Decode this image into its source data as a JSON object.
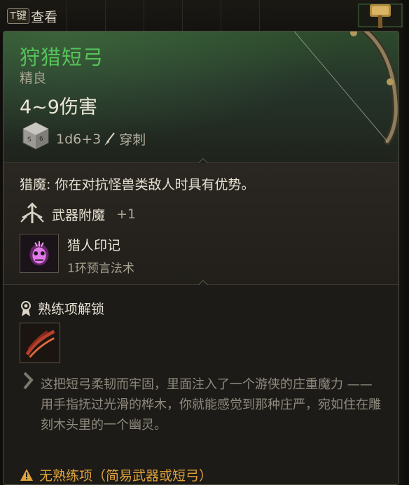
{
  "hotkey": {
    "key": "T键",
    "label": "查看"
  },
  "item": {
    "name": "狩猎短弓",
    "rarity": "精良",
    "damage": "4~9伤害",
    "damage_dice": "1d6+3",
    "damage_type": "穿刺",
    "name_color": "#56c35a"
  },
  "passive": {
    "label": "猎魔:",
    "text": "你在对抗怪兽类敌人时具有优势。"
  },
  "enchant": {
    "label": "武器附魔",
    "bonus": "+1"
  },
  "spell": {
    "name": "猎人印记",
    "level": "1环预言法术",
    "icon": "hunters-mark-icon"
  },
  "proficiency": {
    "label": "熟练项解锁",
    "icon": "slash-attack-icon"
  },
  "lore": {
    "p1": "这把短弓柔韧而牢固，里面注入了一个游侠的庄重魔力 ——",
    "p2": "用手指抚过光滑的桦木，你就能感觉到那种庄严，宛如住在雕刻木头里的一个幽灵。"
  },
  "warning": {
    "text": "无熟练项（简易武器或短弓）",
    "color": "#e0a33a"
  }
}
